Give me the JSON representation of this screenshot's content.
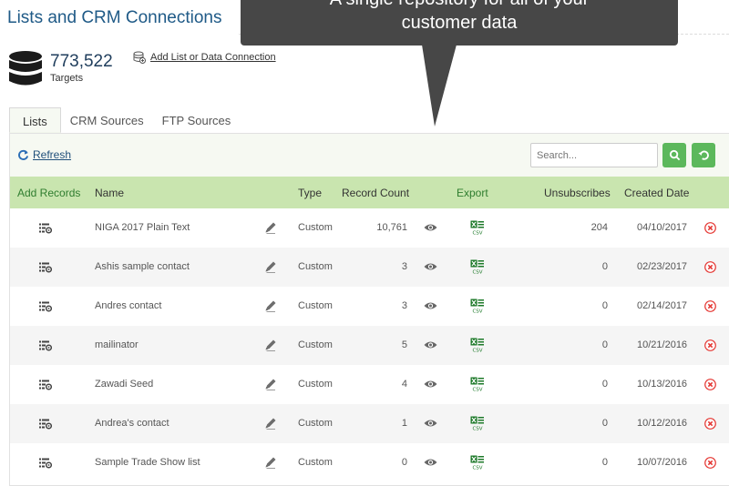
{
  "page": {
    "title": "Lists and CRM Connections"
  },
  "tooltip": {
    "line1": "A single repository for all of your",
    "line2": "customer data"
  },
  "targets": {
    "count": "773,522",
    "label": "Targets"
  },
  "add_list": {
    "label": "Add List or Data Connection"
  },
  "tabs": [
    {
      "label": "Lists",
      "active": true
    },
    {
      "label": "CRM Sources",
      "active": false
    },
    {
      "label": "FTP Sources",
      "active": false
    }
  ],
  "toolbar": {
    "refresh_label": "Refresh",
    "search_placeholder": "Search..."
  },
  "colors": {
    "accent_green": "#5cb85c",
    "header_green": "#c9e5af",
    "title_blue": "#1f5a87",
    "delete_red": "#e53935"
  },
  "table": {
    "columns": {
      "add_records": "Add Records",
      "name": "Name",
      "type": "Type",
      "record_count": "Record Count",
      "export": "Export",
      "unsubscribes": "Unsubscribes",
      "created_date": "Created Date"
    },
    "rows": [
      {
        "name": "NIGA 2017 Plain Text",
        "type": "Custom",
        "record_count": "10,761",
        "unsubscribes": "204",
        "created_date": "04/10/2017"
      },
      {
        "name": "Ashis sample contact",
        "type": "Custom",
        "record_count": "3",
        "unsubscribes": "0",
        "created_date": "02/23/2017"
      },
      {
        "name": "Andres contact",
        "type": "Custom",
        "record_count": "3",
        "unsubscribes": "0",
        "created_date": "02/14/2017"
      },
      {
        "name": "mailinator",
        "type": "Custom",
        "record_count": "5",
        "unsubscribes": "0",
        "created_date": "10/21/2016"
      },
      {
        "name": "Zawadi Seed",
        "type": "Custom",
        "record_count": "4",
        "unsubscribes": "0",
        "created_date": "10/13/2016"
      },
      {
        "name": "Andrea's contact",
        "type": "Custom",
        "record_count": "1",
        "unsubscribes": "0",
        "created_date": "10/12/2016"
      },
      {
        "name": "Sample Trade Show list",
        "type": "Custom",
        "record_count": "0",
        "unsubscribes": "0",
        "created_date": "10/07/2016"
      }
    ]
  }
}
